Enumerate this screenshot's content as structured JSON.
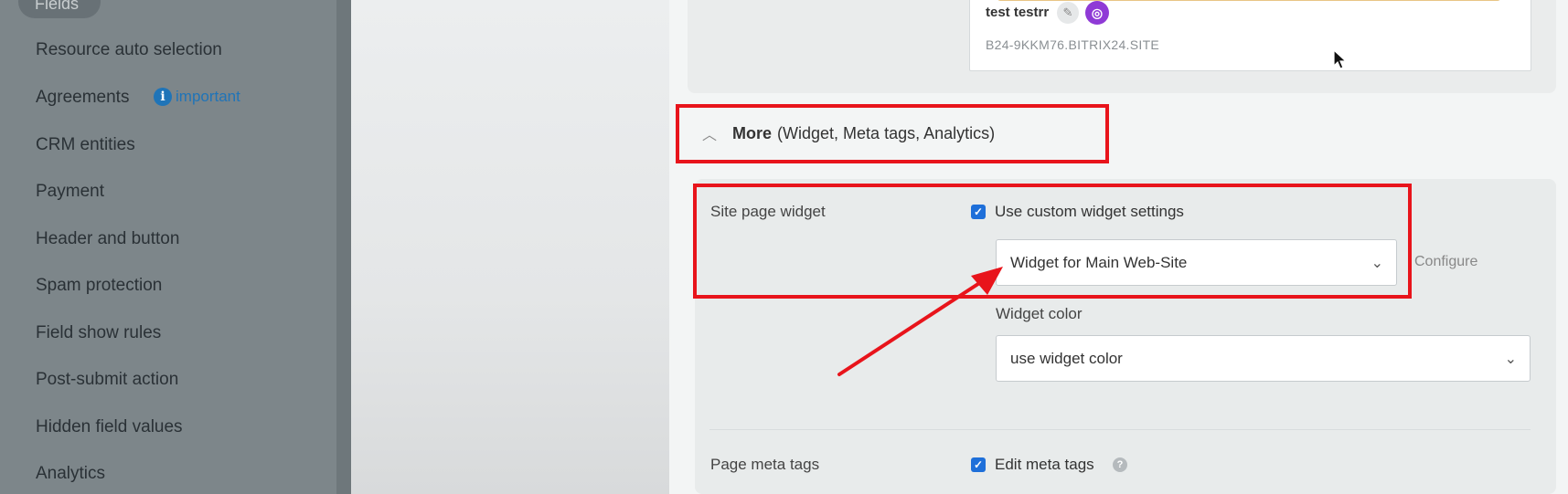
{
  "sidebar": {
    "active_item": "Fields",
    "items": [
      {
        "label": "Resource auto selection"
      },
      {
        "label": "Agreements",
        "badge": "important"
      },
      {
        "label": "CRM entities"
      },
      {
        "label": "Payment"
      },
      {
        "label": "Header and button"
      },
      {
        "label": "Spam protection"
      },
      {
        "label": "Field show rules"
      },
      {
        "label": "Post-submit action"
      },
      {
        "label": "Hidden field values"
      },
      {
        "label": "Analytics"
      }
    ]
  },
  "preview": {
    "user_name": "test testrr",
    "site_url": "B24-9KKM76.BITRIX24.SITE"
  },
  "more_section": {
    "title": "More",
    "subtitle": "(Widget,  Meta tags,  Analytics)"
  },
  "widget": {
    "label": "Site page widget",
    "custom_checkbox_label": "Use custom widget settings",
    "custom_checked": true,
    "selected_widget": "Widget for Main Web-Site",
    "configure_label": "Configure",
    "color_label": "Widget color",
    "color_value": "use widget color"
  },
  "meta": {
    "label": "Page meta tags",
    "checkbox_label": "Edit meta tags",
    "checked": true
  },
  "colors": {
    "annotation": "#e8141b",
    "checkbox": "#1e6fd9",
    "info_badge": "#1f74b8"
  }
}
